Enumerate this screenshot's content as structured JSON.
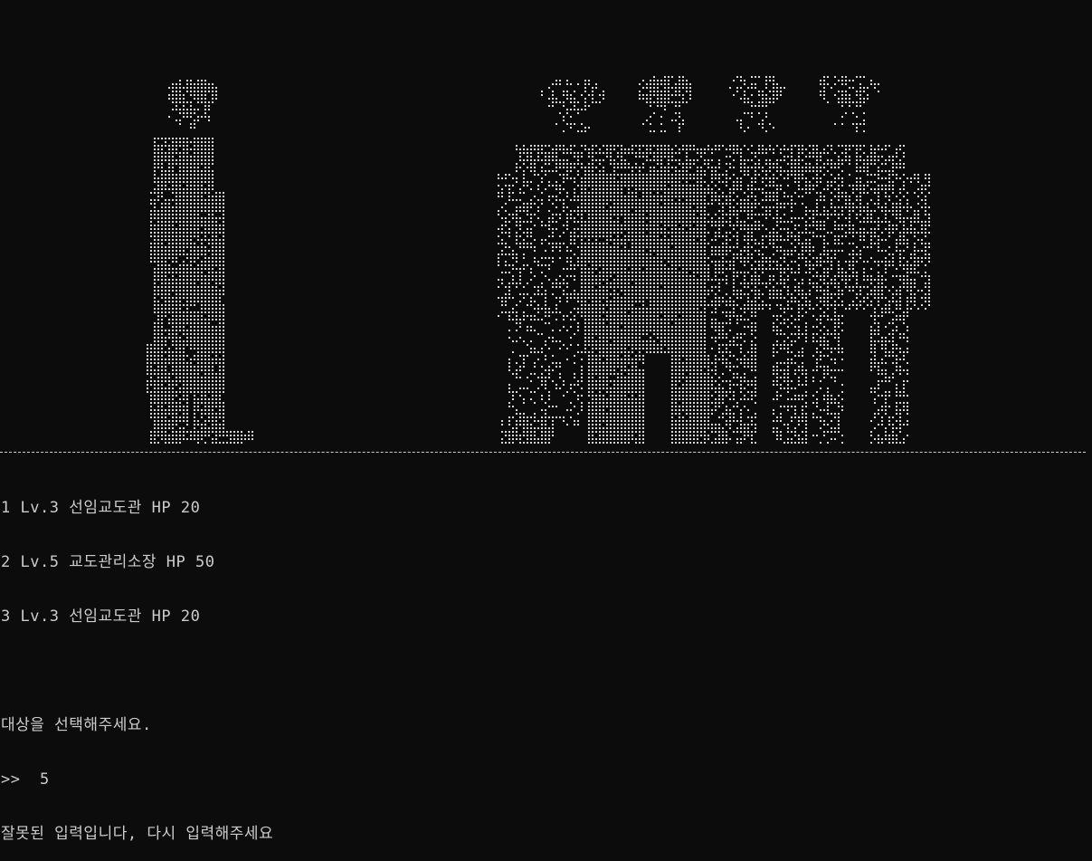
{
  "scene": {
    "player_sprite": "player-ascii-figure",
    "enemy_group_sprite": "guard-group-ascii-figures"
  },
  "targets": [
    {
      "index": "1",
      "level": "Lv.3",
      "name": "선임교도관",
      "hp_label": "HP",
      "hp": "20"
    },
    {
      "index": "2",
      "level": "Lv.5",
      "name": "교도관리소장",
      "hp_label": "HP",
      "hp": "50"
    },
    {
      "index": "3",
      "level": "Lv.3",
      "name": "선임교도관",
      "hp_label": "HP",
      "hp": "20"
    }
  ],
  "prompt": {
    "instruction": "대상을 선택해주세요.",
    "input_prefix": ">>",
    "input_value": "5",
    "error_message": "잘못된 입력입니다, 다시 입력해주세요"
  },
  "colors": {
    "background": "#0c0c0c",
    "text": "#cccccc",
    "art": "#d8d8d8"
  }
}
